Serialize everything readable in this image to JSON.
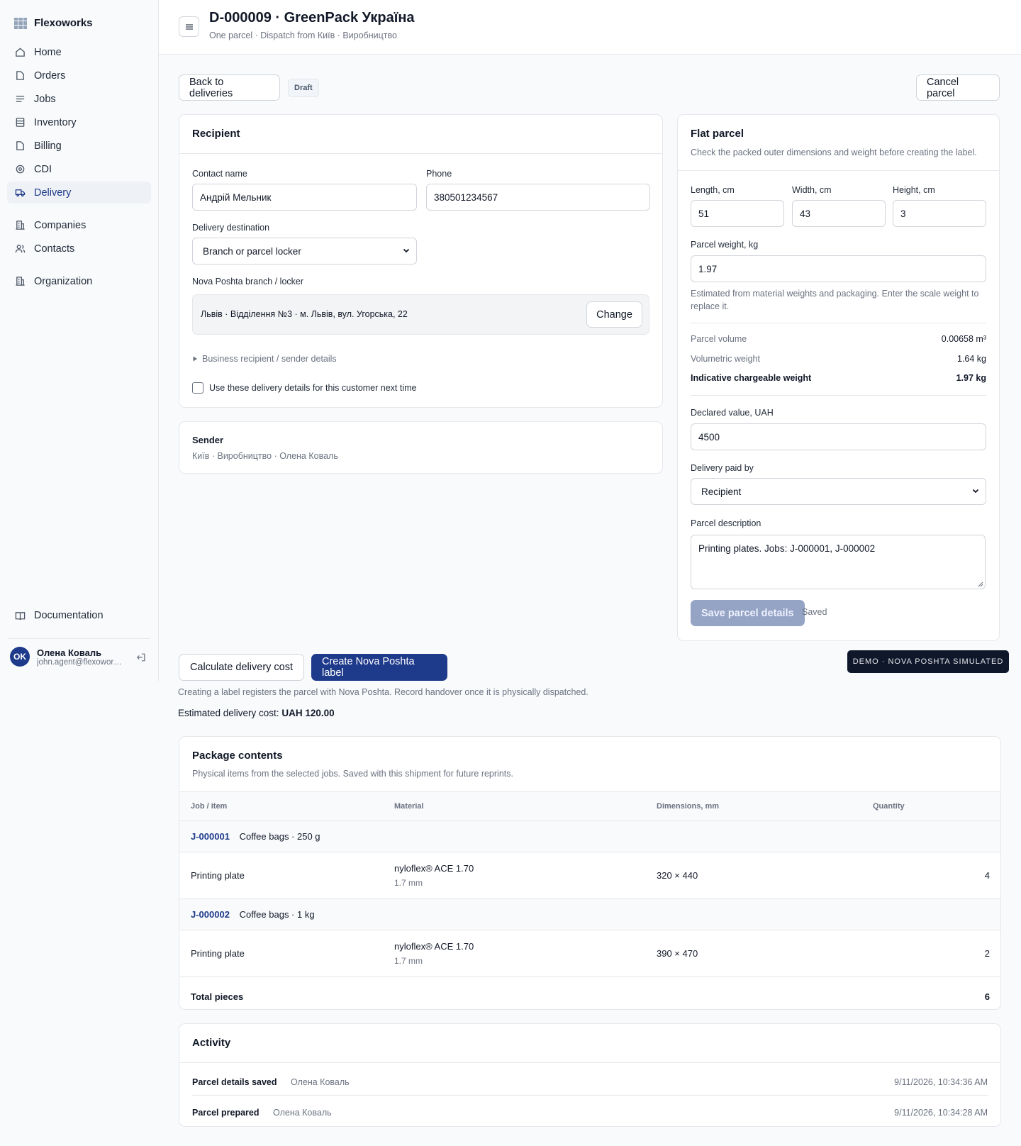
{
  "app": {
    "name": "Flexoworks"
  },
  "sidebar": {
    "items": [
      {
        "label": "Home",
        "icon": "home-icon"
      },
      {
        "label": "Orders",
        "icon": "file-icon"
      },
      {
        "label": "Jobs",
        "icon": "lines-icon"
      },
      {
        "label": "Inventory",
        "icon": "database-icon"
      },
      {
        "label": "Billing",
        "icon": "file-icon"
      },
      {
        "label": "CDI",
        "icon": "target-icon"
      },
      {
        "label": "Delivery",
        "icon": "truck-icon",
        "active": true
      },
      {
        "label": "Companies",
        "icon": "building-icon"
      },
      {
        "label": "Contacts",
        "icon": "users-icon"
      },
      {
        "label": "Organization",
        "icon": "building-icon"
      }
    ],
    "documentation": "Documentation",
    "user": {
      "initials": "OK",
      "name": "Олена Коваль",
      "email": "john.agent@flexoworks.example"
    }
  },
  "header": {
    "title": "D-000009 · GreenPack Україна",
    "subtitle": "One parcel · Dispatch from Київ · Виробництво"
  },
  "actions": {
    "back": "Back to deliveries",
    "status": "Draft",
    "cancel": "Cancel parcel",
    "calculate": "Calculate delivery cost",
    "create_label": "Create Nova Poshta label",
    "demo_badge": "DEMO · NOVA POSHTA SIMULATED",
    "hint": "Creating a label registers the parcel with Nova Poshta. Record handover once it is physically dispatched.",
    "estimate_label": "Estimated delivery cost:",
    "estimate_value": "UAH 120.00"
  },
  "recipient": {
    "title": "Recipient",
    "contact_label": "Contact name",
    "contact_value": "Андрій Мельник",
    "phone_label": "Phone",
    "phone_value": "380501234567",
    "destination_label": "Delivery destination",
    "destination_value": "Branch or parcel locker",
    "branch_label": "Nova Poshta branch / locker",
    "branch_value": "Львів · Відділення №3 · м. Львів, вул. Угорська, 22",
    "change": "Change",
    "business_toggle": "Business recipient / sender details",
    "remember": "Use these delivery details for this customer next time"
  },
  "sender": {
    "title": "Sender",
    "details": "Київ · Виробництво · Олена Коваль"
  },
  "parcel": {
    "title": "Flat parcel",
    "subtitle": "Check the packed outer dimensions and weight before creating the label.",
    "length_label": "Length, cm",
    "length": "51",
    "width_label": "Width, cm",
    "width": "43",
    "height_label": "Height, cm",
    "height": "3",
    "weight_label": "Parcel weight, kg",
    "weight": "1.97",
    "weight_hint": "Estimated from material weights and packaging. Enter the scale weight to replace it.",
    "volume_label": "Parcel volume",
    "volume": "0.00658 m³",
    "volumetric_label": "Volumetric weight",
    "volumetric": "1.64 kg",
    "chargeable_label": "Indicative chargeable weight",
    "chargeable": "1.97 kg",
    "declared_label": "Declared value, UAH",
    "declared": "4500",
    "paid_by_label": "Delivery paid by",
    "paid_by": "Recipient",
    "description_label": "Parcel description",
    "description": "Printing plates. Jobs: J-000001, J-000002",
    "save": "Save parcel details",
    "saved": "Saved"
  },
  "contents": {
    "title": "Package contents",
    "subtitle": "Physical items from the selected jobs. Saved with this shipment for future reprints.",
    "columns": [
      "Job / item",
      "Material",
      "Dimensions, mm",
      "Quantity"
    ],
    "groups": [
      {
        "job": "J-000001",
        "name": "Coffee bags · 250 g",
        "item": "Printing plate",
        "material": "nyloflex® ACE 1.70",
        "thickness": "1.7 mm",
        "dimensions": "320 × 440",
        "quantity": "4"
      },
      {
        "job": "J-000002",
        "name": "Coffee bags · 1 kg",
        "item": "Printing plate",
        "material": "nyloflex® ACE 1.70",
        "thickness": "1.7 mm",
        "dimensions": "390 × 470",
        "quantity": "2"
      }
    ],
    "total_label": "Total pieces",
    "total": "6"
  },
  "activity": {
    "title": "Activity",
    "entries": [
      {
        "event": "Parcel details saved",
        "user": "Олена Коваль",
        "time": "9/11/2026, 10:34:36 AM"
      },
      {
        "event": "Parcel prepared",
        "user": "Олена Коваль",
        "time": "9/11/2026, 10:34:28 AM"
      }
    ]
  }
}
